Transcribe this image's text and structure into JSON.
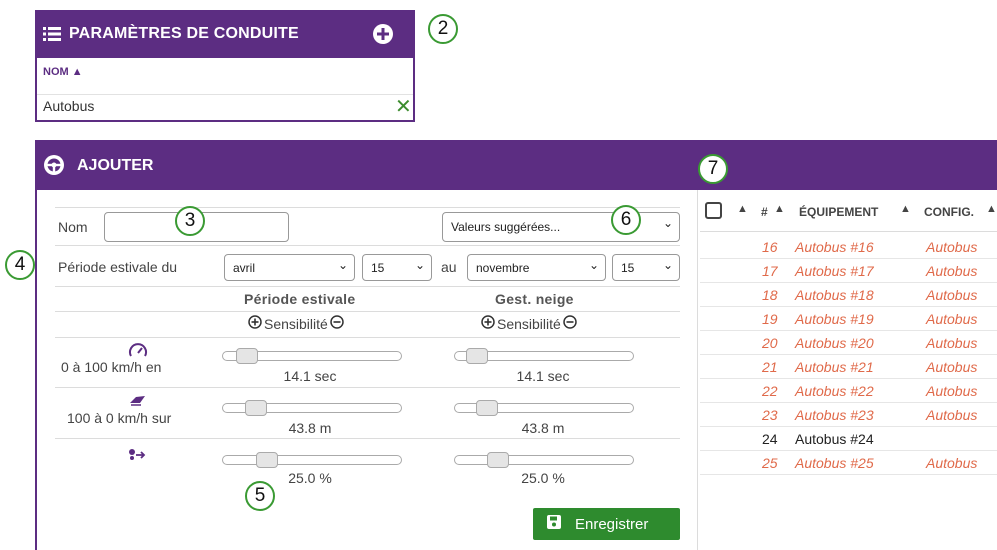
{
  "top_panel": {
    "title": "PARAMÈTRES DE CONDUITE",
    "column_header": "NOM",
    "rows": [
      {
        "name": "Autobus",
        "mark": "✕"
      }
    ]
  },
  "main_panel": {
    "title": "AJOUTER",
    "nom_label": "Nom",
    "nom_value": "",
    "suggested_select": "Valeurs suggérées...",
    "period_label": "Période estivale du",
    "start_month": "avril",
    "start_day": "15",
    "au_label": "au",
    "end_month": "novembre",
    "end_day": "15",
    "col_summer": "Période estivale",
    "col_snow": "Gest. neige",
    "sensitivity_label": "Sensibilité",
    "rows": [
      {
        "icon": "speedometer-icon",
        "label": "0 à 100 km/h en",
        "summer_value": "14.1 sec",
        "snow_value": "14.1 sec",
        "summer_level": 0.08,
        "snow_level": 0.08
      },
      {
        "icon": "braking-icon",
        "label": "100 à 0 km/h sur",
        "summer_value": "43.8 m",
        "snow_value": "43.8 m",
        "summer_level": 0.18,
        "snow_level": 0.18
      },
      {
        "icon": "turn-icon",
        "label": "",
        "summer_value": "25.0 %",
        "snow_value": "25.0 %",
        "summer_level": 0.25,
        "snow_level": 0.25
      }
    ],
    "save_label": "Enregistrer"
  },
  "table": {
    "headers": {
      "num": "#",
      "equipment": "ÉQUIPEMENT",
      "config": "CONFIG."
    },
    "rows": [
      {
        "num": "16",
        "equipment": "Autobus #16",
        "config": "Autobus",
        "alert": true
      },
      {
        "num": "17",
        "equipment": "Autobus #17",
        "config": "Autobus",
        "alert": true
      },
      {
        "num": "18",
        "equipment": "Autobus #18",
        "config": "Autobus",
        "alert": true
      },
      {
        "num": "19",
        "equipment": "Autobus #19",
        "config": "Autobus",
        "alert": true
      },
      {
        "num": "20",
        "equipment": "Autobus #20",
        "config": "Autobus",
        "alert": true
      },
      {
        "num": "21",
        "equipment": "Autobus #21",
        "config": "Autobus",
        "alert": true
      },
      {
        "num": "22",
        "equipment": "Autobus #22",
        "config": "Autobus",
        "alert": true
      },
      {
        "num": "23",
        "equipment": "Autobus #23",
        "config": "Autobus",
        "alert": true
      },
      {
        "num": "24",
        "equipment": "Autobus #24",
        "config": "",
        "alert": false
      },
      {
        "num": "25",
        "equipment": "Autobus #25",
        "config": "Autobus",
        "alert": true
      }
    ]
  },
  "callouts": [
    "2",
    "3",
    "4",
    "5",
    "6",
    "7"
  ],
  "colors": {
    "brand": "#5c2d82",
    "save": "#2e8b2e",
    "alert": "#e06a4a",
    "callout": "#3a9a33"
  }
}
